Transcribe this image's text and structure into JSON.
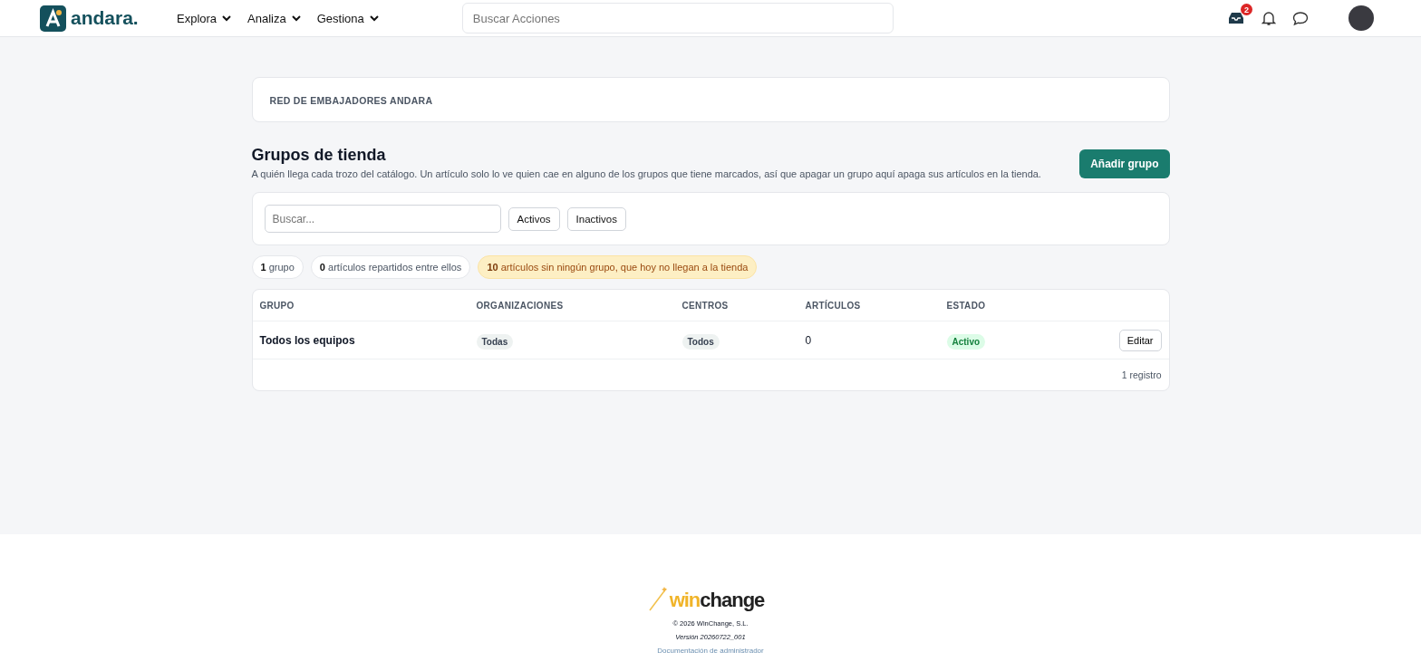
{
  "nav": {
    "logo": "andara.",
    "menus": [
      {
        "label": "Explora"
      },
      {
        "label": "Analiza"
      },
      {
        "label": "Gestiona"
      }
    ],
    "search": {
      "placeholder": "Buscar Acciones"
    },
    "inbox_badge": "2"
  },
  "breadcrumb": "RED DE EMBAJADORES ANDARA",
  "header": {
    "title": "Grupos de tienda",
    "description": "A quién llega cada trozo del catálogo. Un artículo solo lo ve quien cae en alguno de los grupos que tiene marcados, así que apagar un grupo aquí apaga sus artículos en la tienda.",
    "add_button": "Añadir grupo"
  },
  "filters": {
    "search": {
      "placeholder": "Buscar..."
    },
    "buttons": [
      {
        "label": "Activos",
        "selected": false
      },
      {
        "label": "Inactivos",
        "selected": false
      }
    ]
  },
  "stats": [
    {
      "count": "1",
      "text": "grupo",
      "kind": "plain"
    },
    {
      "count": "0",
      "text": "artículos repartidos entre ellos",
      "kind": "plain"
    },
    {
      "count": "10",
      "text": "artículos sin ningún grupo, que hoy no llegan a la tienda",
      "kind": "warning"
    }
  ],
  "table": {
    "columns": [
      "GRUPO",
      "ORGANIZACIONES",
      "CENTROS",
      "ARTÍCULOS",
      "ESTADO"
    ],
    "rows": [
      {
        "grupo": "Todos los equipos",
        "organizaciones": "Todas",
        "centros": "Todos",
        "articulos": "0",
        "estado": "Activo",
        "action": "Editar"
      }
    ],
    "footer": "1 registro"
  },
  "footer": {
    "brand_prefix": "win",
    "brand_suffix": "change",
    "copyright": "© 2026 WinChange, S.L.",
    "version": "Versión 20260722_001",
    "doc_link": "Documentación de administrador"
  }
}
